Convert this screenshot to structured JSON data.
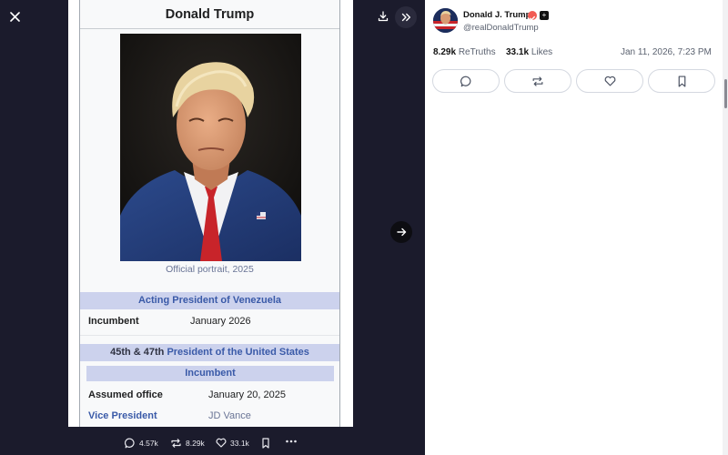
{
  "viewer": {
    "icons": {
      "close": "close-icon",
      "download": "download-icon",
      "expand": "double-chevron-right-icon",
      "next": "arrow-right-icon"
    }
  },
  "infobox": {
    "name": "Donald Trump",
    "caption": "Official portrait, 2025",
    "sections": {
      "venezuela": "Acting President of Venezuela",
      "usa_prefix": "45th & 47th",
      "usa_office": "President of the United States",
      "incumbent": "Incumbent"
    },
    "rows": {
      "incumbent": {
        "label": "Incumbent",
        "value": "January 2026"
      },
      "assumed": {
        "label": "Assumed office",
        "value": "January 20, 2025"
      },
      "vp": {
        "label": "Vice President",
        "value": "JD Vance"
      }
    }
  },
  "media_bar": {
    "replies": "4.57k",
    "retruths": "8.29k",
    "likes": "33.1k"
  },
  "post": {
    "author_name": "Donald J. Trump",
    "author_handle": "@realDonaldTrump",
    "retruths_count": "8.29k",
    "retruths_label": "ReTruths",
    "likes_count": "33.1k",
    "likes_label": "Likes",
    "date": "Jan 11, 2026, 7:23 PM"
  },
  "colors": {
    "viewer_bg": "#1b1b2c",
    "infobox_header": "#ccd2ed",
    "link": "#3a5aa8",
    "verified": "#f25c54"
  }
}
